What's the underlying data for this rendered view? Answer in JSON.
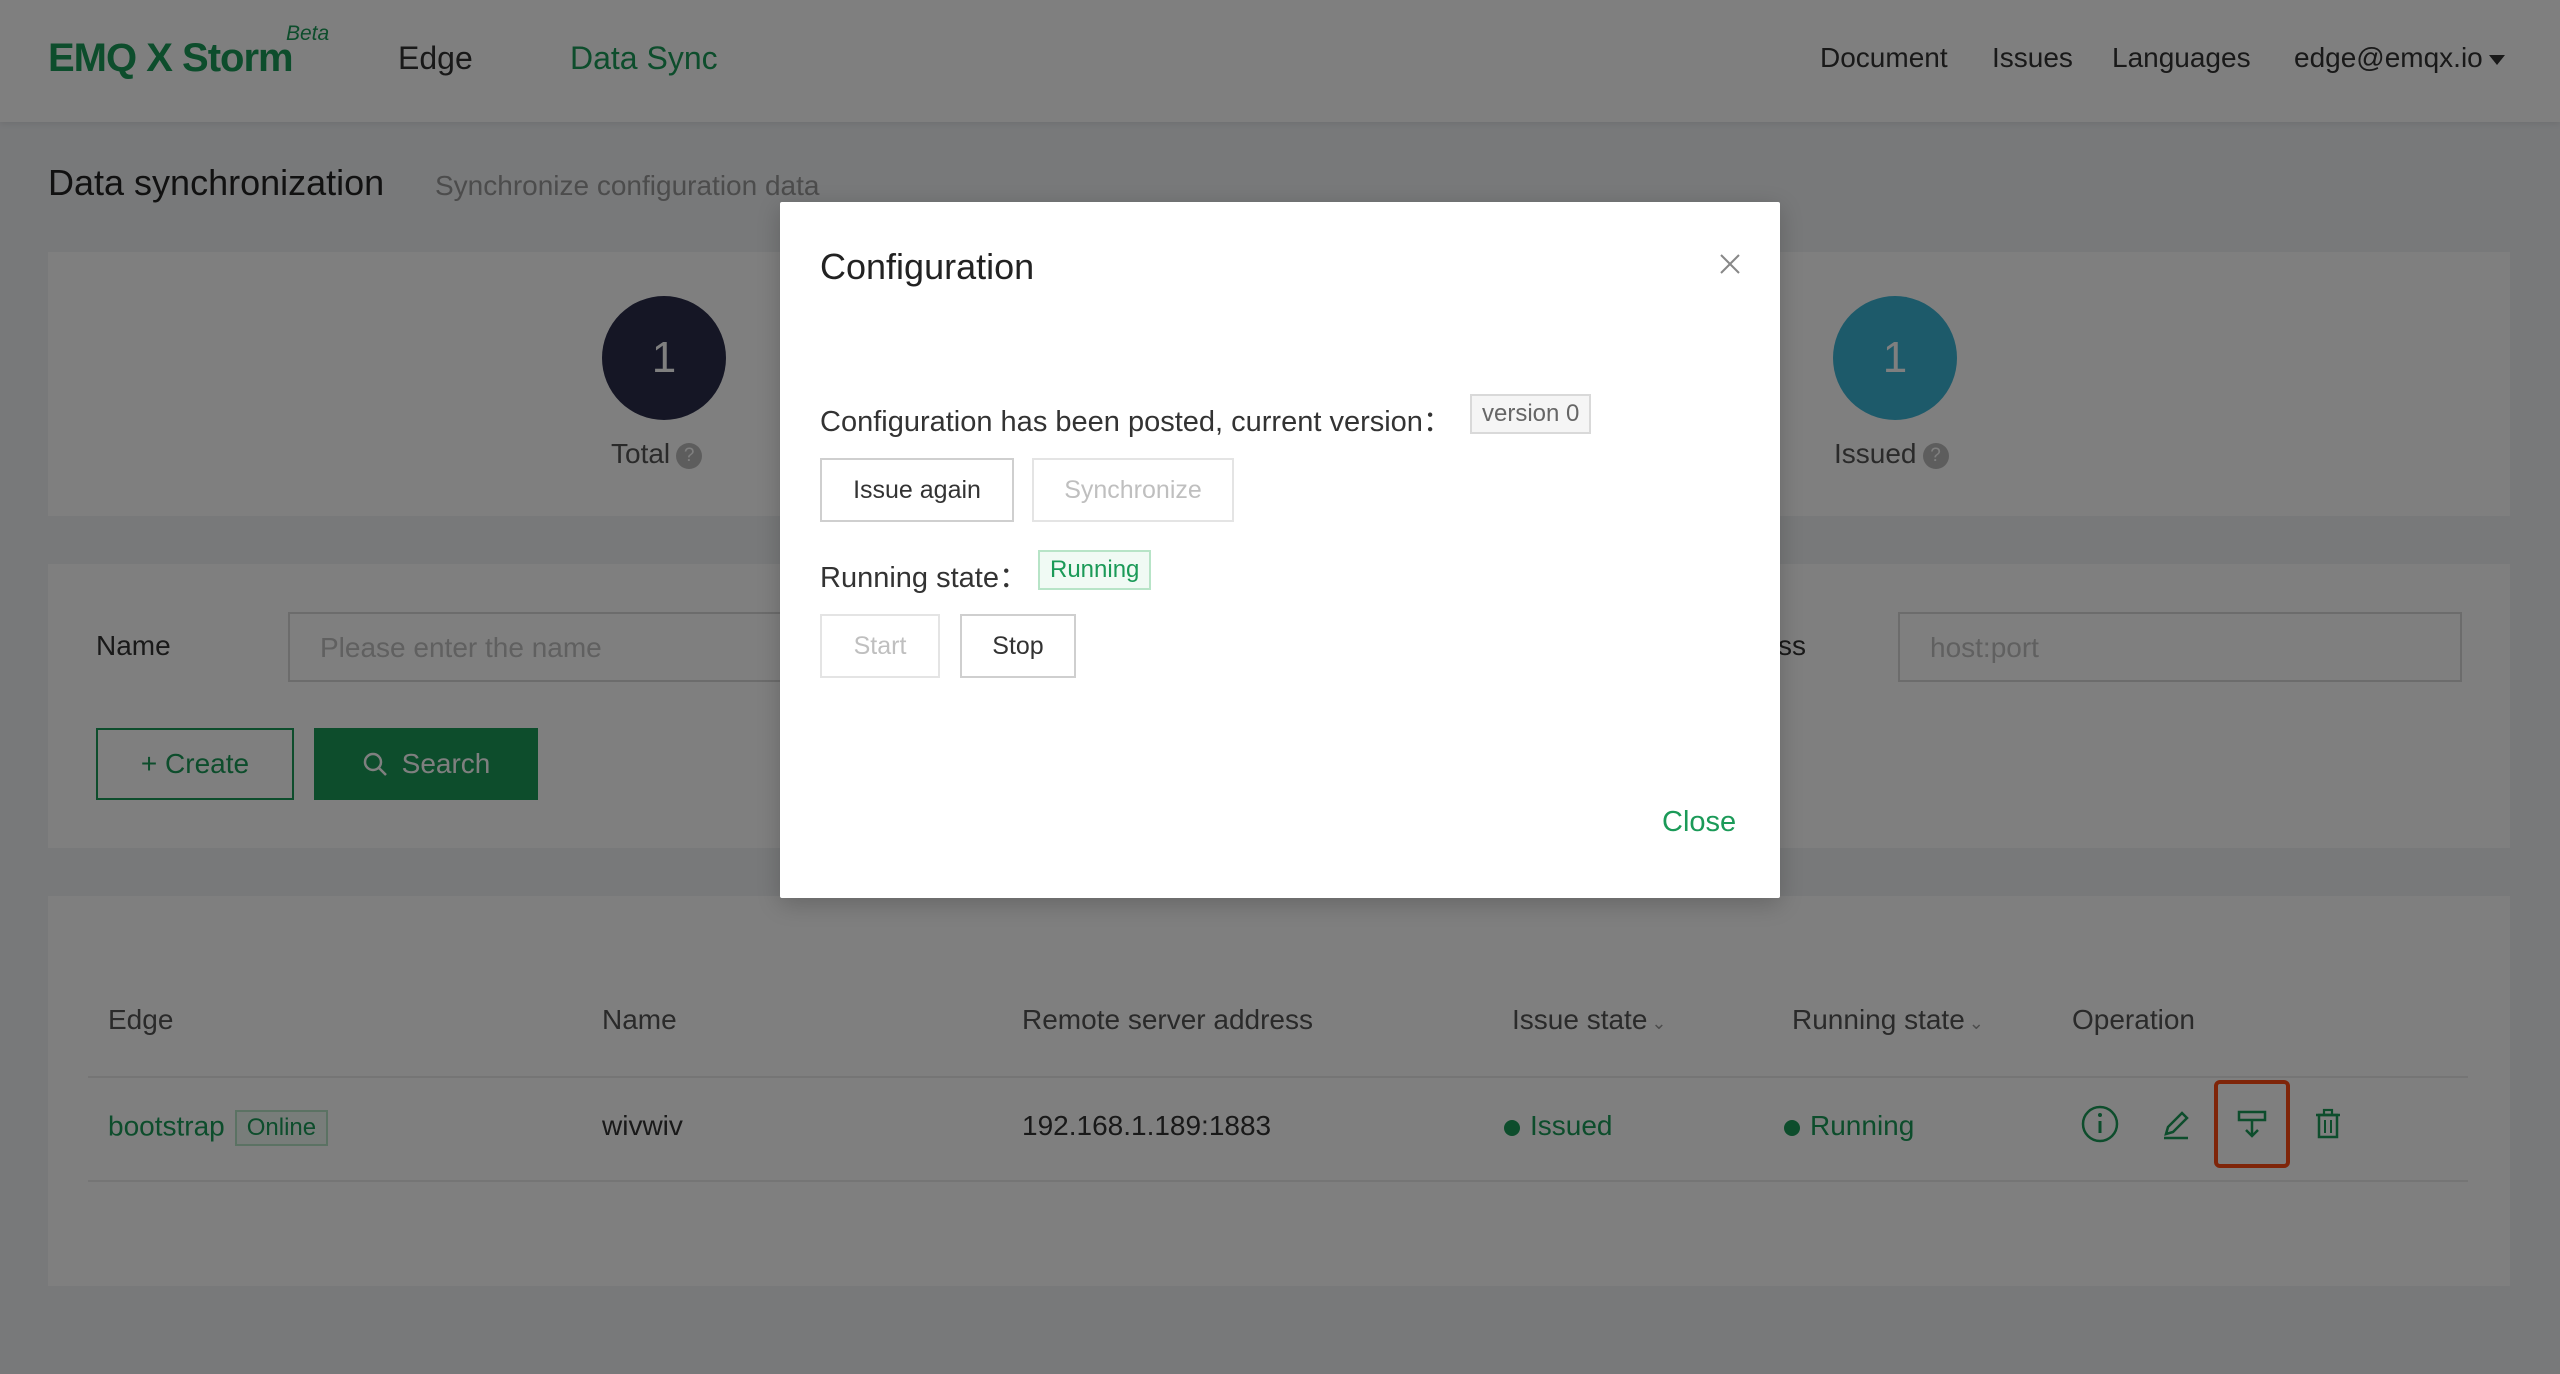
{
  "header": {
    "logo": "EMQ X Storm",
    "badge": "Beta",
    "nav": [
      "Edge",
      "Data Sync"
    ],
    "links": {
      "document": "Document",
      "issues": "Issues",
      "languages": "Languages",
      "user": "edge@emqx.io"
    }
  },
  "page": {
    "title": "Data synchronization",
    "subtitle": "Synchronize configuration data"
  },
  "stats": {
    "total": {
      "value": "1",
      "label": "Total"
    },
    "issued": {
      "value": "1",
      "label": "Issued"
    }
  },
  "filter": {
    "name_label": "Name",
    "name_placeholder": "Please enter the name",
    "address_label": "ss",
    "address_placeholder": "host:port",
    "create_label": "+ Create",
    "search_label": "Search"
  },
  "table": {
    "columns": [
      "Edge",
      "Name",
      "Remote server address",
      "Issue state",
      "Running state",
      "Operation"
    ],
    "rows": [
      {
        "edge": "bootstrap",
        "edge_status": "Online",
        "name": "wivwiv",
        "address": "192.168.1.189:1883",
        "issue_state": "Issued",
        "running_state": "Running"
      }
    ]
  },
  "modal": {
    "title": "Configuration",
    "posted_text": "Configuration has been posted, current version：",
    "version_tag": "version 0",
    "issue_again": "Issue again",
    "synchronize": "Synchronize",
    "running_text": "Running state：",
    "running_tag": "Running",
    "start": "Start",
    "stop": "Stop",
    "close": "Close"
  },
  "colors": {
    "brand": "#1b9a58",
    "highlight": "#ff4a13",
    "total_circle": "#2a2c4a",
    "issued_circle": "#3bb4d4"
  }
}
